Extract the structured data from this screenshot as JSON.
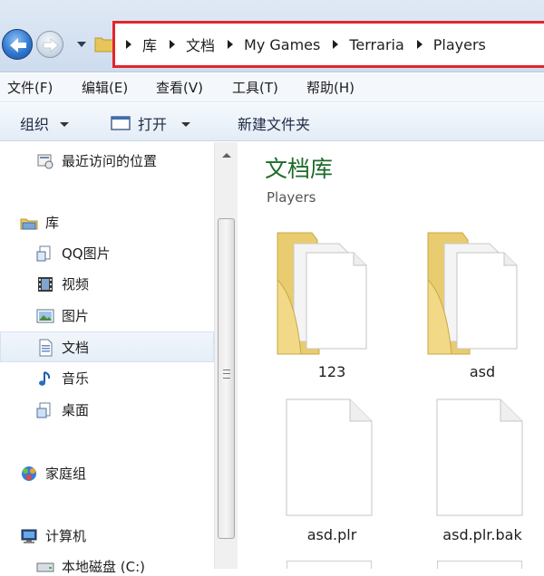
{
  "address": {
    "crumbs": [
      "库",
      "文档",
      "My Games",
      "Terraria",
      "Players"
    ]
  },
  "menu": [
    "文件(F)",
    "编辑(E)",
    "查看(V)",
    "工具(T)",
    "帮助(H)"
  ],
  "toolbar": {
    "organize": "组织",
    "open": "打开",
    "new_folder": "新建文件夹"
  },
  "nav": {
    "recent": "最近访问的位置",
    "libraries": "库",
    "qq_pictures": "QQ图片",
    "videos": "视频",
    "pictures": "图片",
    "documents": "文档",
    "music": "音乐",
    "desktop": "桌面",
    "homegroup": "家庭组",
    "computer": "计算机",
    "local_disk": "本地磁盘 (C:)"
  },
  "content": {
    "library_title": "文档库",
    "library_subtitle": "Players",
    "items": [
      {
        "name": "123",
        "type": "folder"
      },
      {
        "name": "asd",
        "type": "folder"
      },
      {
        "name": "asd.plr",
        "type": "file"
      },
      {
        "name": "asd.plr.bak",
        "type": "file"
      }
    ]
  },
  "colors": {
    "accent_red": "#e2252b",
    "library_title_green": "#1e6b2b"
  }
}
